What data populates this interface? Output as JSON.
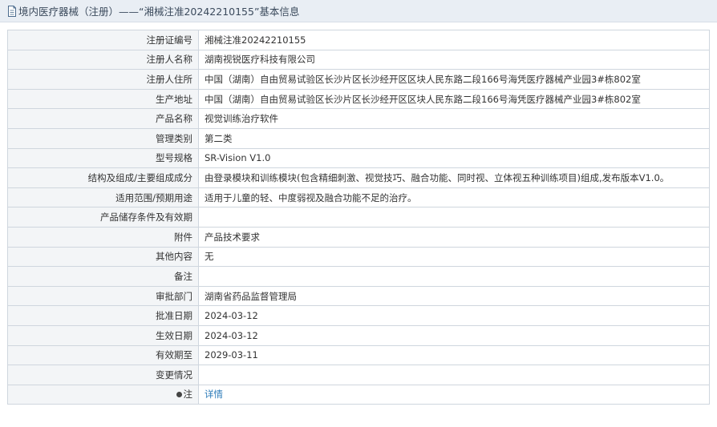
{
  "header": {
    "title": "境内医疗器械（注册）——“湘械注准20242210155”基本信息",
    "icon": "document-icon"
  },
  "rows": [
    {
      "label": "注册证编号",
      "value": "湘械注准20242210155"
    },
    {
      "label": "注册人名称",
      "value": "湖南视锐医疗科技有限公司"
    },
    {
      "label": "注册人住所",
      "value": "中国（湖南）自由贸易试验区长沙片区长沙经开区区块人民东路二段166号海凭医疗器械产业园3#栋802室"
    },
    {
      "label": "生产地址",
      "value": "中国（湖南）自由贸易试验区长沙片区长沙经开区区块人民东路二段166号海凭医疗器械产业园3#栋802室"
    },
    {
      "label": "产品名称",
      "value": "视觉训练治疗软件"
    },
    {
      "label": "管理类别",
      "value": "第二类"
    },
    {
      "label": "型号规格",
      "value": "SR-Vision V1.0"
    },
    {
      "label": "结构及组成/主要组成成分",
      "value": "由登录模块和训练模块(包含精细刺激、视觉技巧、融合功能、同时视、立体视五种训练项目)组成,发布版本V1.0。"
    },
    {
      "label": "适用范围/预期用途",
      "value": "适用于儿童的轻、中度弱视及融合功能不足的治疗。"
    },
    {
      "label": "产品储存条件及有效期",
      "value": ""
    },
    {
      "label": "附件",
      "value": "产品技术要求"
    },
    {
      "label": "其他内容",
      "value": "无"
    },
    {
      "label": "备注",
      "value": ""
    },
    {
      "label": "审批部门",
      "value": "湖南省药品监督管理局"
    },
    {
      "label": "批准日期",
      "value": "2024-03-12"
    },
    {
      "label": "生效日期",
      "value": "2024-03-12"
    },
    {
      "label": "有效期至",
      "value": "2029-03-11"
    },
    {
      "label": "变更情况",
      "value": ""
    }
  ],
  "note_row": {
    "label": "注",
    "link_text": "详情",
    "icon": "pin-icon"
  }
}
